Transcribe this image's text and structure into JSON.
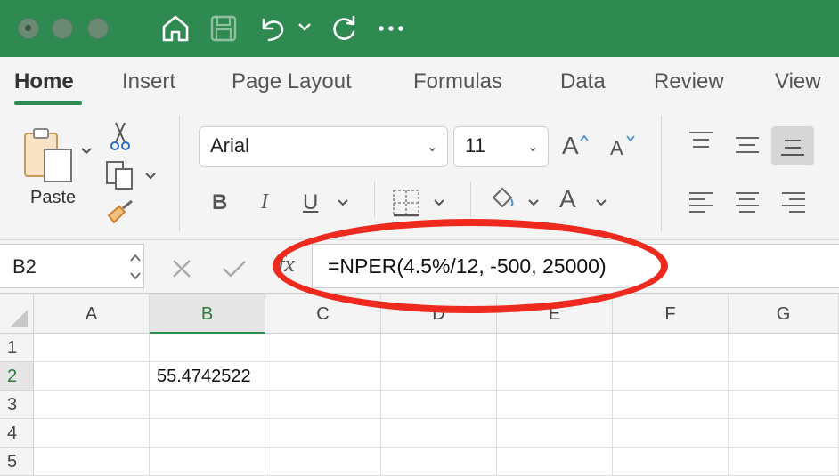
{
  "ribbon": {
    "tabs": [
      "Home",
      "Insert",
      "Page Layout",
      "Formulas",
      "Data",
      "Review",
      "View"
    ],
    "active_tab": "Home",
    "paste_label": "Paste",
    "font_name": "Arial",
    "font_size": "11",
    "bold_label": "B",
    "italic_label": "I",
    "underline_label": "U",
    "grow_font_label": "A",
    "shrink_font_label": "A",
    "font_color_label": "A"
  },
  "formula_bar": {
    "name_box": "B2",
    "fx_label": "fx",
    "formula": "=NPER(4.5%/12, -500, 25000)"
  },
  "sheet": {
    "columns": [
      "A",
      "B",
      "C",
      "D",
      "E",
      "F",
      "G"
    ],
    "rows": [
      "1",
      "2",
      "3",
      "4",
      "5"
    ],
    "selected_column": "B",
    "selected_row": "2",
    "cells": {
      "B2": "55.4742522"
    }
  },
  "colors": {
    "title_bar": "#2f8a52",
    "annotation": "#ee2a1f",
    "highlight": "#f2e600",
    "font_color": "#e06666"
  }
}
